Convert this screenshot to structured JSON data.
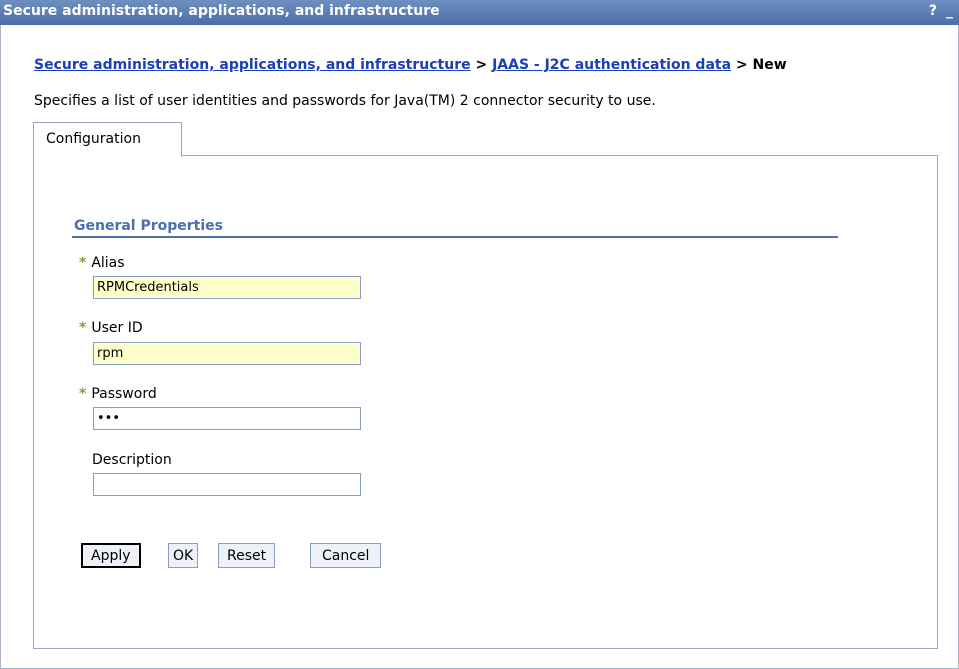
{
  "window": {
    "title": "Secure administration, applications, and infrastructure",
    "help_icon": "?",
    "minimize_icon": "_"
  },
  "breadcrumb": {
    "link1": "Secure administration, applications, and infrastructure",
    "sep1": " > ",
    "link2": "JAAS - J2C authentication data",
    "sep2": " > ",
    "current": "New"
  },
  "description": "Specifies a list of user identities and passwords for Java(TM) 2 connector security to use.",
  "tabs": [
    {
      "label": "Configuration"
    }
  ],
  "section": {
    "title": "General Properties"
  },
  "fields": {
    "alias": {
      "label": "Alias",
      "value": "RPMCredentials",
      "required": "*"
    },
    "user_id": {
      "label": "User ID",
      "value": "rpm",
      "required": "*"
    },
    "password": {
      "label": "Password",
      "value": "abc",
      "required": "*"
    },
    "description": {
      "label": "Description",
      "value": ""
    }
  },
  "buttons": {
    "apply": "Apply",
    "ok": "OK",
    "reset": "Reset",
    "cancel": "Cancel"
  },
  "colors": {
    "title_bar": "#4a6ea8",
    "link": "#1a3fb8",
    "section_title": "#4b6eaf",
    "required_marker": "#7aa33f",
    "required_field_bg": "#ffffcc"
  }
}
